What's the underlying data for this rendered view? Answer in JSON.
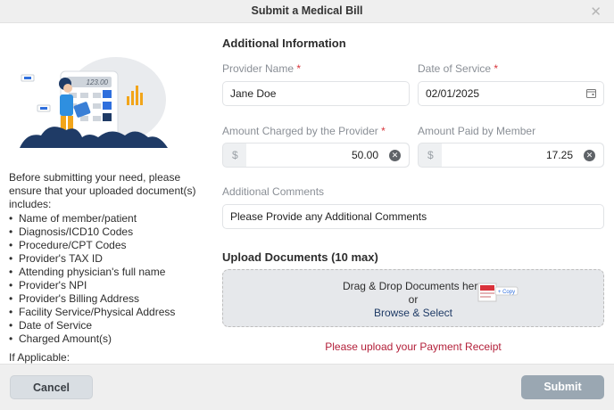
{
  "dialog": {
    "title": "Submit a Medical Bill"
  },
  "illustration": {
    "calculator_display": "123.00"
  },
  "instructions": {
    "intro": "Before submitting your need, please ensure that your uploaded document(s) includes:",
    "items": [
      "Name of member/patient",
      "Diagnosis/ICD10 Codes",
      "Procedure/CPT Codes",
      "Provider's TAX ID",
      "Attending physician's full name",
      "Provider's NPI",
      "Provider's Billing Address",
      "Facility Service/Physical Address",
      "Date of Service",
      "Charged Amount(s)"
    ],
    "more": "If Applicable:"
  },
  "form": {
    "section_title": "Additional Information",
    "provider_name": {
      "label": "Provider Name",
      "value": "Jane Doe"
    },
    "date_of_service": {
      "label": "Date of Service",
      "value": "02/01/2025"
    },
    "amount_charged": {
      "label": "Amount Charged by the Provider",
      "currency": "$",
      "value": "50.00"
    },
    "amount_paid": {
      "label": "Amount Paid by Member",
      "currency": "$",
      "value": "17.25"
    },
    "comments": {
      "label": "Additional Comments",
      "placeholder": "Please Provide any Additional Comments"
    },
    "required_mark": "*"
  },
  "upload": {
    "title": "Upload Documents (10 max)",
    "drag_text": "Drag & Drop Documents here",
    "or_text": "or",
    "browse_text": "Browse & Select",
    "drag_badge": "+ Copy",
    "error": "Please upload your Payment Receipt"
  },
  "footer": {
    "cancel_label": "Cancel",
    "submit_label": "Submit"
  },
  "colors": {
    "required": "#d8343b",
    "error": "#b3203a",
    "link": "#1f3b66",
    "submit_disabled": "#9aa7b2"
  }
}
